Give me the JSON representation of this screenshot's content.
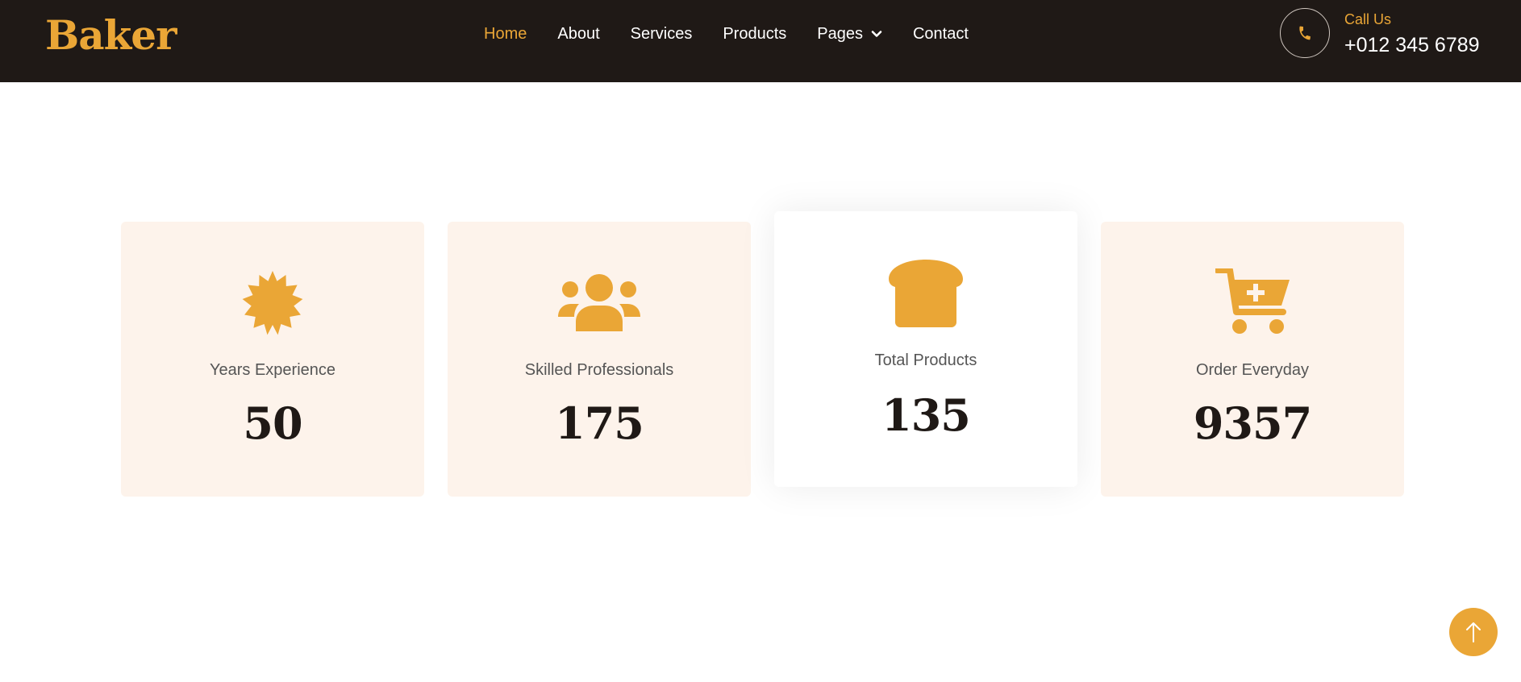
{
  "brand": {
    "name": "Baker"
  },
  "nav": {
    "items": [
      {
        "label": "Home"
      },
      {
        "label": "About"
      },
      {
        "label": "Services"
      },
      {
        "label": "Products"
      },
      {
        "label": "Pages"
      },
      {
        "label": "Contact"
      }
    ],
    "active": "Home"
  },
  "contact": {
    "label": "Call Us",
    "phone": "+012 345 6789"
  },
  "stats": [
    {
      "icon": "certificate-icon",
      "label": "Years Experience",
      "value": "50"
    },
    {
      "icon": "users-icon",
      "label": "Skilled Professionals",
      "value": "175"
    },
    {
      "icon": "bread-icon",
      "label": "Total Products",
      "value": "135"
    },
    {
      "icon": "cart-plus-icon",
      "label": "Order Everyday",
      "value": "9357"
    }
  ],
  "colors": {
    "accent": "#eaa636",
    "dark": "#1f1916",
    "card_bg": "#fdf3eb"
  },
  "back_to_top": {
    "icon": "arrow-up-icon"
  }
}
